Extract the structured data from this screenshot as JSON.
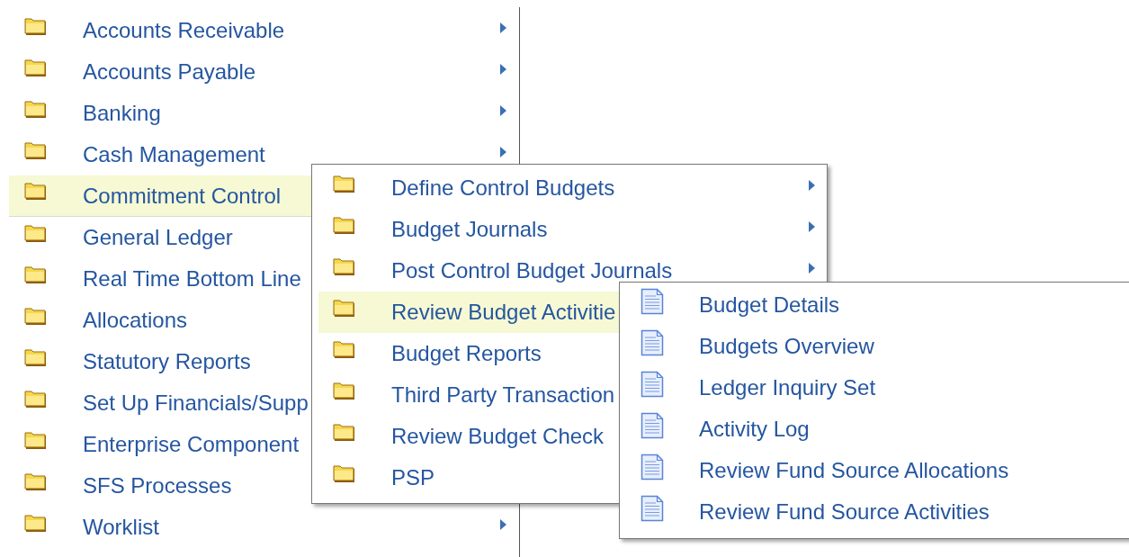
{
  "main_menu": {
    "items": [
      {
        "label": "Accounts Receivable",
        "selected": false,
        "submenu": true
      },
      {
        "label": "Accounts Payable",
        "selected": false,
        "submenu": true
      },
      {
        "label": "Banking",
        "selected": false,
        "submenu": true
      },
      {
        "label": "Cash Management",
        "selected": false,
        "submenu": true
      },
      {
        "label": "Commitment Control",
        "selected": true,
        "submenu": false
      },
      {
        "label": "General Ledger",
        "selected": false,
        "submenu": false
      },
      {
        "label": "Real Time Bottom Line",
        "selected": false,
        "submenu": false
      },
      {
        "label": "Allocations",
        "selected": false,
        "submenu": false
      },
      {
        "label": "Statutory Reports",
        "selected": false,
        "submenu": false
      },
      {
        "label": "Set Up Financials/Supp",
        "selected": false,
        "submenu": false
      },
      {
        "label": "Enterprise Component",
        "selected": false,
        "submenu": false
      },
      {
        "label": "SFS Processes",
        "selected": false,
        "submenu": false
      },
      {
        "label": "Worklist",
        "selected": false,
        "submenu": true
      }
    ]
  },
  "submenu": {
    "items": [
      {
        "label": "Define Control Budgets",
        "selected": false,
        "submenu": true
      },
      {
        "label": "Budget Journals",
        "selected": false,
        "submenu": true
      },
      {
        "label": "Post Control Budget Journals",
        "selected": false,
        "submenu": true
      },
      {
        "label": "Review Budget Activitie",
        "selected": true,
        "submenu": false
      },
      {
        "label": "Budget Reports",
        "selected": false,
        "submenu": false
      },
      {
        "label": "Third Party Transaction",
        "selected": false,
        "submenu": false
      },
      {
        "label": "Review Budget Check",
        "selected": false,
        "submenu": false
      },
      {
        "label": "PSP",
        "selected": false,
        "submenu": false
      }
    ]
  },
  "pages_menu": {
    "items": [
      {
        "label": "Budget Details"
      },
      {
        "label": "Budgets Overview"
      },
      {
        "label": "Ledger Inquiry Set"
      },
      {
        "label": "Activity Log"
      },
      {
        "label": "Review Fund Source Allocations"
      },
      {
        "label": "Review Fund Source Activities"
      }
    ]
  }
}
